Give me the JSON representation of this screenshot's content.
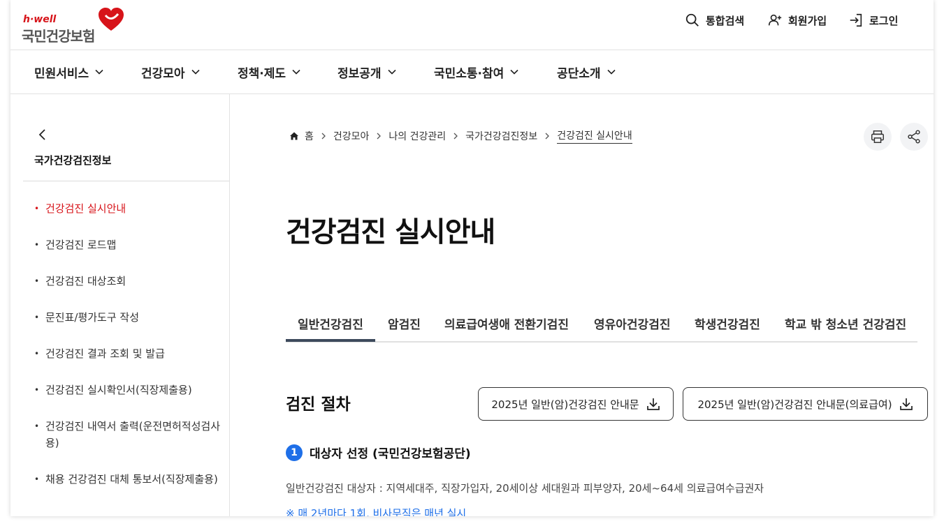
{
  "brand": {
    "tagline": "h·well",
    "name": "국민건강보험",
    "accent": "#d7141a"
  },
  "utility": {
    "search": "통합검색",
    "join": "회원가입",
    "login": "로그인"
  },
  "gnb": [
    {
      "label": "민원서비스"
    },
    {
      "label": "건강모아"
    },
    {
      "label": "정책·제도"
    },
    {
      "label": "정보공개"
    },
    {
      "label": "국민소통·참여"
    },
    {
      "label": "공단소개"
    }
  ],
  "sidebar": {
    "title": "국가건강검진정보",
    "items": [
      {
        "label": "건강검진 실시안내",
        "active": true
      },
      {
        "label": "건강검진 로드맵"
      },
      {
        "label": "건강검진 대상조회"
      },
      {
        "label": "문진표/평가도구 작성"
      },
      {
        "label": "건강검진 결과 조회 및 발급"
      },
      {
        "label": "건강검진 실시확인서(직장제출용)"
      },
      {
        "label": "건강검진 내역서 출력(운전면허적성검사용)"
      },
      {
        "label": "채용 건강검진 대체 통보서(직장제출용)"
      }
    ]
  },
  "breadcrumb": [
    "홈",
    "건강모아",
    "나의 건강관리",
    "국가건강검진정보",
    "건강검진 실시안내"
  ],
  "page_title": "건강검진 실시안내",
  "tabs": [
    {
      "label": "일반건강검진",
      "active": true
    },
    {
      "label": "암검진"
    },
    {
      "label": "의료급여생애 전환기검진"
    },
    {
      "label": "영유아건강검진"
    },
    {
      "label": "학생건강검진"
    },
    {
      "label": "학교 밖 청소년 건강검진"
    }
  ],
  "section": {
    "title": "검진 절차",
    "download1": "2025년 일반(암)건강검진 안내문",
    "download2": "2025년 일반(암)건강검진 안내문(의료급여)",
    "step_number": "1",
    "step_title": "대상자 선정 (국민건강보험공단)",
    "description": "일반건강검진 대상자 : 지역세대주, 직장가입자, 20세이상 세대원과 피부양자, 20세~64세 의료급여수급권자",
    "note": "※ 매 2년마다 1회, 비사무직은 매년 실시"
  }
}
